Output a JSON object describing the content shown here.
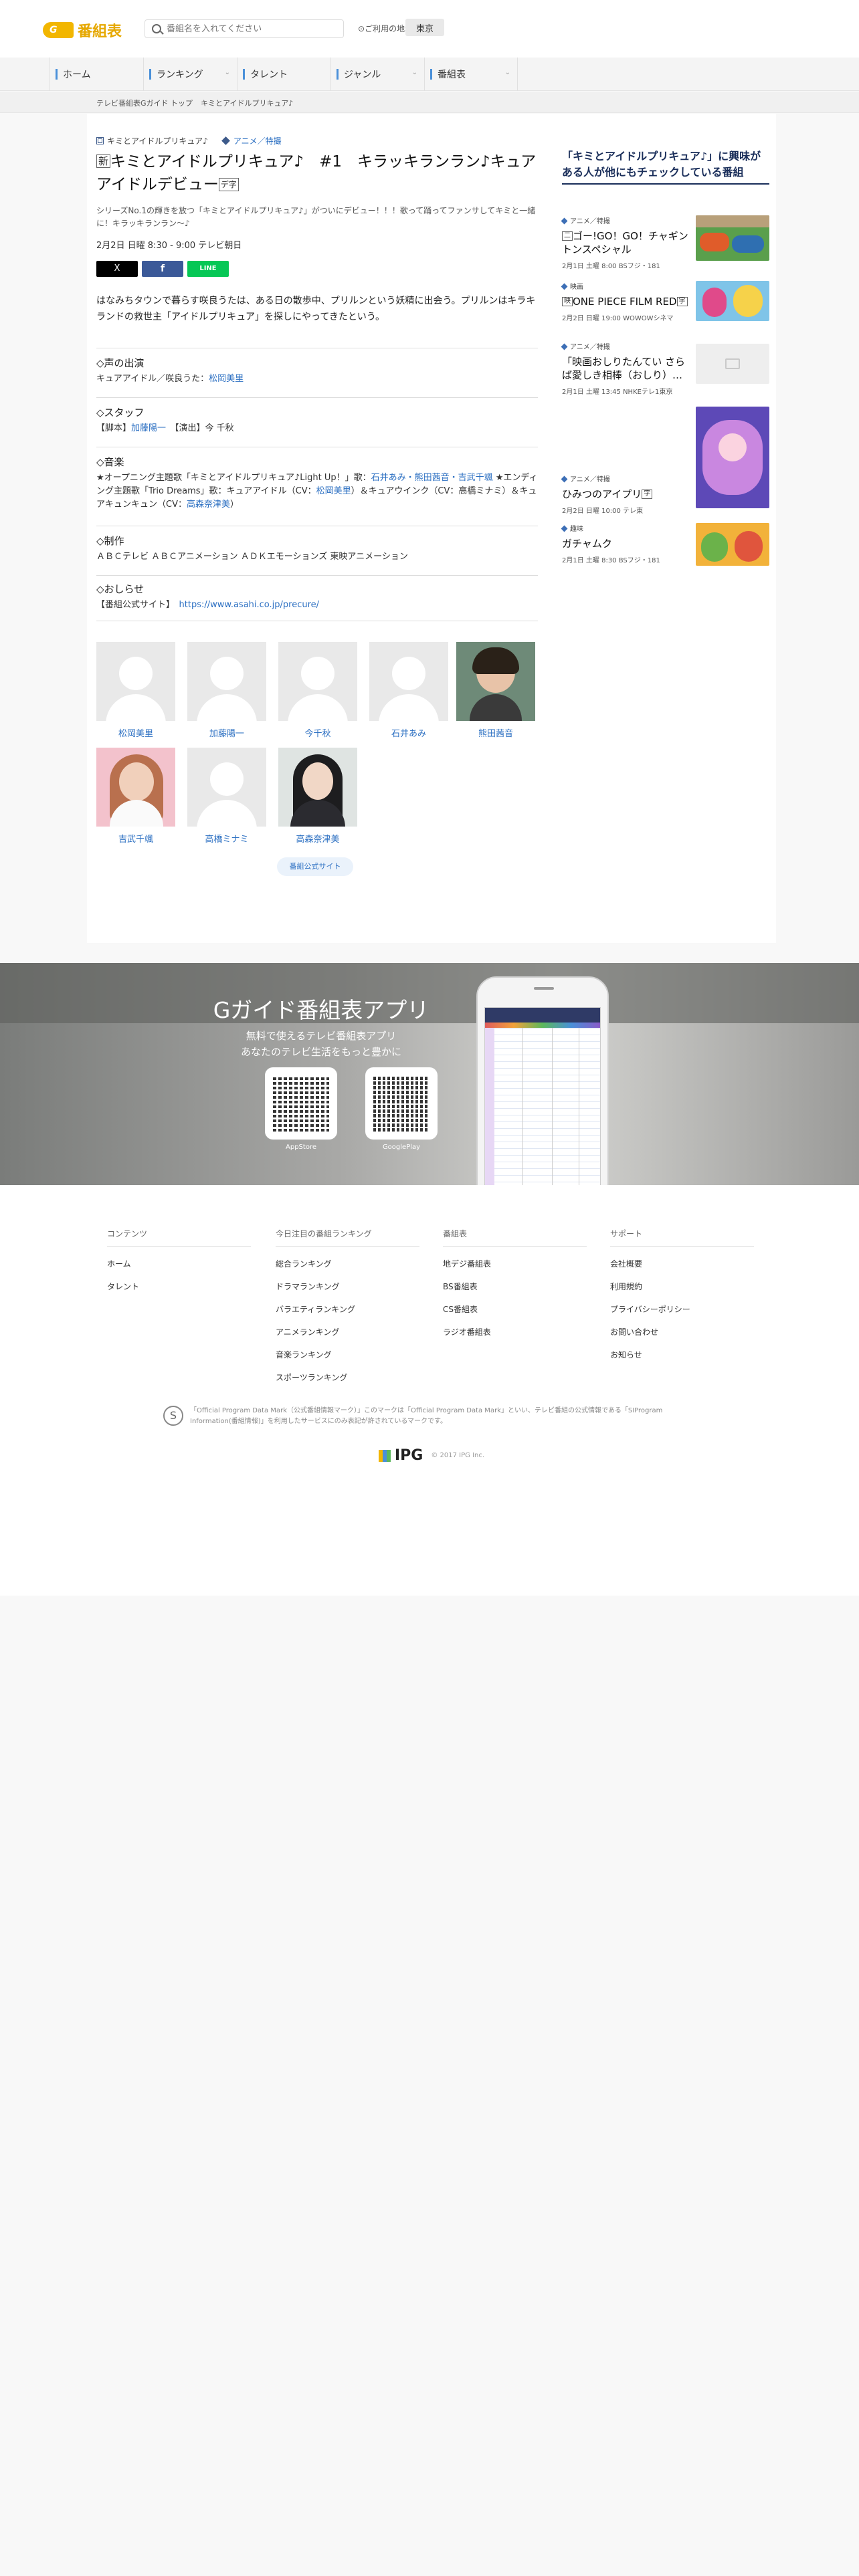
{
  "header": {
    "logo_g": "G",
    "logo_text": "番組表",
    "search_placeholder": "番組名を入れてください",
    "region_label": "ご利用の地域",
    "region_button": "東京"
  },
  "nav": [
    "ホーム",
    "ランキング",
    "タレント",
    "ジャンル",
    "番組表"
  ],
  "breadcrumb": [
    "テレビ番組表Gガイド トップ",
    "キミとアイドルプリキュア♪"
  ],
  "program": {
    "series_tag": "キミとアイドルプリキュア♪",
    "genre_tag": "アニメ／特撮",
    "badge_new": "新",
    "title": "キミとアイドルプリキュア♪　#1　キラッキランラン♪キュアアイドルデビュー",
    "badge_caption": "デ字",
    "lead": "シリーズNo.1の輝きを放つ「キミとアイドルプリキュア♪」がついにデビュー！！！歌って踊ってファンサしてキミと一緒に！キラッキランラン〜♪",
    "datetime": "2月2日 日曜 8:30 - 9:00 テレビ朝日",
    "share": [
      "X",
      "f",
      "LINE"
    ],
    "description": "はなみちタウンで暮らす咲良うたは、ある日の散歩中、プリルンという妖精に出会う。プリルンはキラキランドの救世主「アイドルプリキュア」を探しにやってきたという。",
    "voice_h": "◇声の出演",
    "voice_role": "キュアアイドル／咲良うた：",
    "voice_actor": "松岡美里",
    "staff_h": "◇スタッフ",
    "staff_pre": "【脚本】",
    "staff_writer": "加藤陽一",
    "staff_mid": "　【演出】今 千秋",
    "music_h": "◇音楽",
    "music_1": "★オープニング主題歌「キミとアイドルプリキュア♪Light Up！」歌：",
    "music_1_a": "石井あみ・熊田茜音・吉武千颯",
    "music_2": " ★エンディング主題歌「Trio Dreams」歌：キュアアイドル（CV：",
    "music_2_a": "松岡美里",
    "music_3": "）＆キュアウインク（CV：高橋ミナミ）＆キュアキュンキュン（CV：",
    "music_3_a": "高森奈津美",
    "music_4": "）",
    "production_h": "◇制作",
    "production_b": "ＡＢＣテレビ ＡＢＣアニメーション ＡＤＫエモーションズ 東映アニメーション",
    "notice_h": "◇おしらせ",
    "notice_pre": "【番組公式サイト】　",
    "notice_url": "https://www.asahi.co.jp/precure/"
  },
  "cast": [
    "松岡美里",
    "加藤陽一",
    "今千秋",
    "石井あみ",
    "熊田茜音",
    "吉武千颯",
    "高橋ミナミ",
    "高森奈津美"
  ],
  "official_button": "番組公式サイト",
  "sidebar": {
    "heading": "「キミとアイドルプリキュア♪」に興味がある人が他にもチェックしている番組",
    "items": [
      {
        "cat": "アニメ／特撮",
        "title": "ゴー!GO！GO！チャギントンスペシャル",
        "time": "2月1日 土曜 8:00 BSフジ・181"
      },
      {
        "cat": "映画",
        "title": "ONE PIECE FILM RED",
        "time": "2月2日 日曜 19:00 WOWOWシネマ"
      },
      {
        "cat": "アニメ／特撮",
        "title": "「映画おしりたんてい さらば愛しき相棒（おしり）…",
        "time": "2月1日 土曜 13:45 NHKEテレ1東京"
      },
      {
        "cat": "アニメ／特撮",
        "title": "ひみつのアイプリ",
        "time": "2月2日 日曜 10:00 テレ東"
      },
      {
        "cat": "趣味",
        "title": "ガチャムク",
        "time": "2月1日 土曜 8:30 BSフジ・181"
      }
    ]
  },
  "promo": {
    "title": "Gガイド番組表アプリ",
    "sub1": "無料で使えるテレビ番組表アプリ",
    "sub2": "あなたのテレビ生活をもっと豊かに",
    "qr1": "AppStore",
    "qr2": "GooglePlay"
  },
  "footer": {
    "cols": [
      {
        "h": "コンテンツ",
        "links": [
          "ホーム",
          "タレント"
        ]
      },
      {
        "h": "今日注目の番組ランキング",
        "links": [
          "総合ランキング",
          "ドラマランキング",
          "バラエティランキング",
          "アニメランキング",
          "音楽ランキング",
          "スポーツランキング"
        ]
      },
      {
        "h": "番組表",
        "links": [
          "地デジ番組表",
          "BS番組表",
          "CS番組表",
          "ラジオ番組表"
        ]
      },
      {
        "h": "サポート",
        "links": [
          "会社概要",
          "利用規約",
          "プライバシーポリシー",
          "お問い合わせ",
          "お知らせ"
        ]
      }
    ],
    "odm": "「Official Program Data Mark（公式番組情報マーク）」このマークは「Official Program Data Mark」といい、テレビ番組の公式情報である「SIProgram Information(番組情報)」を利用したサービスにのみ表記が許されているマークです。",
    "ipg": "IPG",
    "copyright": "© 2017 IPG Inc."
  }
}
